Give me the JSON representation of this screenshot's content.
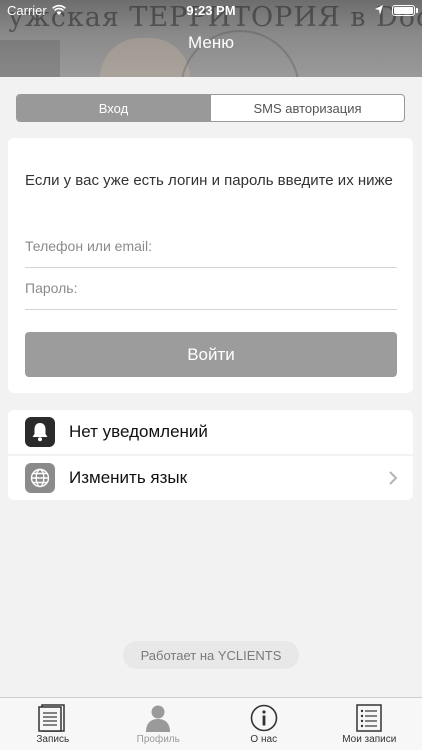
{
  "status_bar": {
    "carrier": "Carrier",
    "time": "9:23 PM"
  },
  "header": {
    "banner_text": "ужская ТЕРРИТОРИЯ в Dockio",
    "title": "Меню"
  },
  "auth_tabs": [
    {
      "label": "Вход",
      "active": true
    },
    {
      "label": "SMS авторизация",
      "active": false
    }
  ],
  "login": {
    "intro": "Если у вас уже есть логин и пароль введите их ниже",
    "phone_placeholder": "Телефон или email:",
    "password_placeholder": "Пароль:",
    "submit_label": "Войти"
  },
  "menu": {
    "notifications": {
      "label": "Нет уведомлений",
      "icon": "bell-icon"
    },
    "language": {
      "label": "Изменить язык",
      "icon": "globe-icon"
    }
  },
  "powered_by": "Работает на YCLIENTS",
  "tabbar": [
    {
      "label": "Запись",
      "icon": "document-icon"
    },
    {
      "label": "Профиль",
      "icon": "person-icon"
    },
    {
      "label": "О нас",
      "icon": "info-icon"
    },
    {
      "label": "Мои записи",
      "icon": "list-icon"
    }
  ],
  "colors": {
    "accent_gray": "#9c9c9c",
    "background": "#f2f2f2"
  }
}
